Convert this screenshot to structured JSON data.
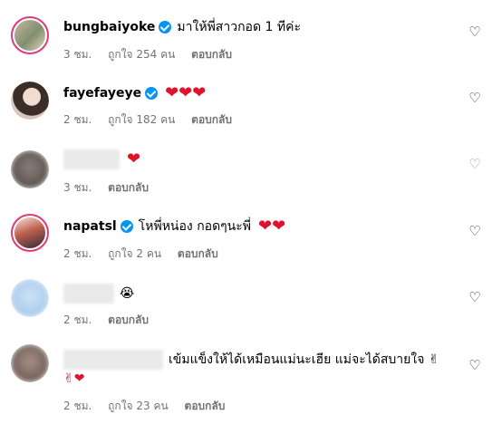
{
  "comments": [
    {
      "user": "bungbaiyoke",
      "verified": true,
      "text": "มาให้พี่สาวกอด 1 ทีค่ะ",
      "hearts": "",
      "time": "3 ชม.",
      "likes": "ถูกใจ 254 คน",
      "reply": "ตอบกลับ"
    },
    {
      "user": "fayefayeye",
      "verified": true,
      "text": "",
      "hearts": "❤❤❤",
      "time": "2 ชม.",
      "likes": "ถูกใจ 182 คน",
      "reply": "ตอบกลับ"
    },
    {
      "user": "",
      "verified": false,
      "text": "",
      "hearts": "❤",
      "time": "3 ชม.",
      "likes": "",
      "reply": "ตอบกลับ"
    },
    {
      "user": "napatsl",
      "verified": true,
      "text": "โหพี่หน่อง กอดๆนะพี่",
      "hearts": "❤❤",
      "time": "2 ชม.",
      "likes": "ถูกใจ 2 คน",
      "reply": "ตอบกลับ"
    },
    {
      "user": "",
      "verified": false,
      "text": "😭",
      "hearts": "",
      "time": "2 ชม.",
      "likes": "",
      "reply": "ตอบกลับ"
    },
    {
      "user": "",
      "verified": false,
      "text": "เข้มแข็งให้ได้เหมือนแม่นะเฮีย แม่จะได้สบายใจ ✌",
      "text_line2": "✌❤",
      "time": "2 ชม.",
      "likes": "ถูกใจ 23 คน",
      "reply": "ตอบกลับ"
    }
  ],
  "icons": {
    "like": "heart-outline-icon",
    "verified": "verified-badge-icon"
  },
  "colors": {
    "verified": "#0095f6",
    "heart": "#e0112b",
    "meta": "#737373"
  }
}
